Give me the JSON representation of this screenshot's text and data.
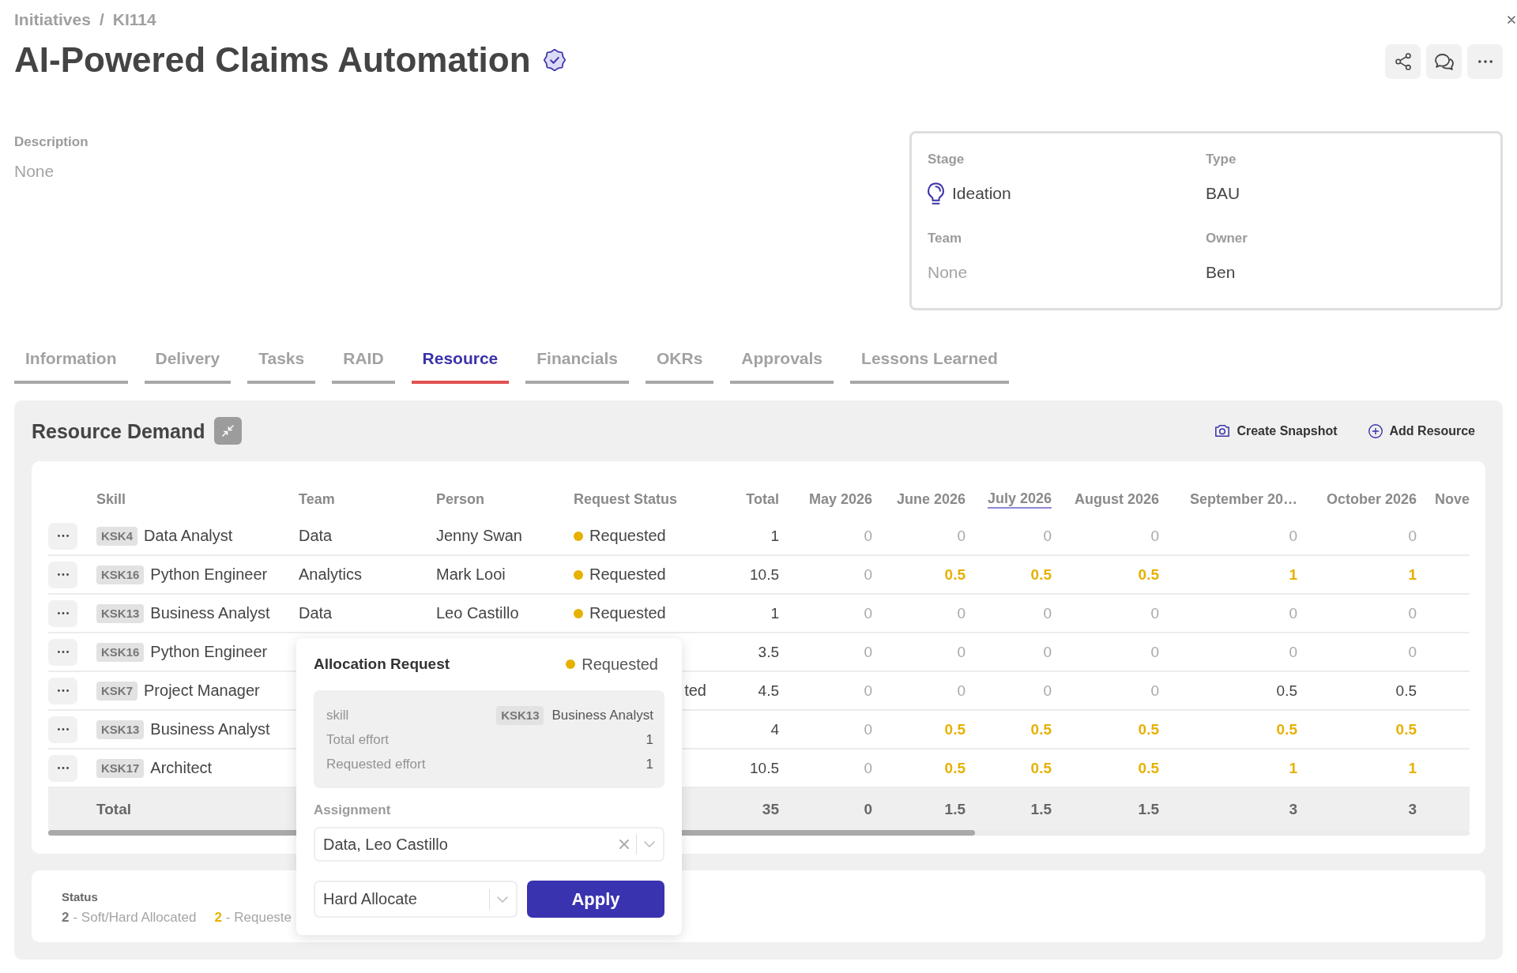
{
  "breadcrumb": {
    "items": [
      "Initiatives",
      "KI114"
    ],
    "separator": "/"
  },
  "title": "AI-Powered Claims Automation",
  "verified": true,
  "header_actions": [
    {
      "kind": "share"
    },
    {
      "kind": "comments"
    },
    {
      "kind": "more"
    }
  ],
  "description": {
    "label": "Description",
    "value": "None",
    "kind": "empty"
  },
  "details": [
    {
      "label": "Stage",
      "value": "Ideation",
      "kind": "stage"
    },
    {
      "label": "Type",
      "value": "BAU",
      "kind": "text"
    },
    {
      "label": "Team",
      "value": "None",
      "kind": "empty"
    },
    {
      "label": "Owner",
      "value": "Ben",
      "kind": "text"
    }
  ],
  "tabs": [
    {
      "label": "Information",
      "selected": false
    },
    {
      "label": "Delivery",
      "selected": false
    },
    {
      "label": "Tasks",
      "selected": false
    },
    {
      "label": "RAID",
      "selected": false
    },
    {
      "label": "Resource",
      "selected": true
    },
    {
      "label": "Financials",
      "selected": false
    },
    {
      "label": "OKRs",
      "selected": false
    },
    {
      "label": "Approvals",
      "selected": false
    },
    {
      "label": "Lessons Learned",
      "selected": false
    }
  ],
  "resource_demand": {
    "title": "Resource Demand",
    "actions": [
      {
        "label": "Create Snapshot",
        "kind": "snapshot"
      },
      {
        "label": "Add Resource",
        "kind": "add"
      }
    ],
    "table": {
      "columns": [
        {
          "label": "Skill",
          "kind": "text",
          "current": false
        },
        {
          "label": "Team",
          "kind": "text",
          "current": false
        },
        {
          "label": "Person",
          "kind": "text",
          "current": false
        },
        {
          "label": "Request Status",
          "kind": "text",
          "current": false
        },
        {
          "label": "Total",
          "kind": "number",
          "current": false
        },
        {
          "label": "May 2026",
          "kind": "month",
          "current": false
        },
        {
          "label": "June 2026",
          "kind": "month",
          "current": false
        },
        {
          "label": "July 2026",
          "kind": "month",
          "current": true
        },
        {
          "label": "August 2026",
          "kind": "month",
          "current": false
        },
        {
          "label": "September 20…",
          "kind": "month",
          "current": false
        },
        {
          "label": "October 2026",
          "kind": "month",
          "current": false
        },
        {
          "label": "Nove",
          "kind": "month",
          "current": false
        }
      ],
      "rows": [
        {
          "code": "KSK4",
          "skill": "Data Analyst",
          "team": "Data",
          "person": "Jenny Swan",
          "status": {
            "label": "Requested",
            "kind": "requested"
          },
          "total": "1",
          "months": [
            {
              "value": "0",
              "kind": "zero"
            },
            {
              "value": "0",
              "kind": "zero"
            },
            {
              "value": "0",
              "kind": "zero"
            },
            {
              "value": "0",
              "kind": "zero"
            },
            {
              "value": "0",
              "kind": "zero"
            },
            {
              "value": "0",
              "kind": "zero"
            }
          ]
        },
        {
          "code": "KSK16",
          "skill": "Python Engineer",
          "team": "Analytics",
          "person": "Mark Looi",
          "status": {
            "label": "Requested",
            "kind": "requested"
          },
          "total": "10.5",
          "months": [
            {
              "value": "0",
              "kind": "zero"
            },
            {
              "value": "0.5",
              "kind": "requested"
            },
            {
              "value": "0.5",
              "kind": "requested"
            },
            {
              "value": "0.5",
              "kind": "requested"
            },
            {
              "value": "1",
              "kind": "requested"
            },
            {
              "value": "1",
              "kind": "requested"
            }
          ]
        },
        {
          "code": "KSK13",
          "skill": "Business Analyst",
          "team": "Data",
          "person": "Leo Castillo",
          "status": {
            "label": "Requested",
            "kind": "requested"
          },
          "total": "1",
          "months": [
            {
              "value": "0",
              "kind": "zero"
            },
            {
              "value": "0",
              "kind": "zero"
            },
            {
              "value": "0",
              "kind": "zero"
            },
            {
              "value": "0",
              "kind": "zero"
            },
            {
              "value": "0",
              "kind": "zero"
            },
            {
              "value": "0",
              "kind": "zero"
            }
          ]
        },
        {
          "code": "KSK16",
          "skill": "Python Engineer",
          "total": "3.5",
          "months": [
            {
              "value": "0",
              "kind": "zero"
            },
            {
              "value": "0",
              "kind": "zero"
            },
            {
              "value": "0",
              "kind": "zero"
            },
            {
              "value": "0",
              "kind": "zero"
            },
            {
              "value": "0",
              "kind": "zero"
            },
            {
              "value": "0",
              "kind": "zero"
            }
          ]
        },
        {
          "code": "KSK7",
          "skill": "Project Manager",
          "status": {
            "label": "ted",
            "kind": "cut"
          },
          "total": "4.5",
          "months": [
            {
              "value": "0",
              "kind": "zero"
            },
            {
              "value": "0",
              "kind": "zero"
            },
            {
              "value": "0",
              "kind": "zero"
            },
            {
              "value": "0",
              "kind": "zero"
            },
            {
              "value": "0.5",
              "kind": "allocated"
            },
            {
              "value": "0.5",
              "kind": "allocated"
            }
          ]
        },
        {
          "code": "KSK13",
          "skill": "Business Analyst",
          "total": "4",
          "months": [
            {
              "value": "0",
              "kind": "zero"
            },
            {
              "value": "0.5",
              "kind": "requested"
            },
            {
              "value": "0.5",
              "kind": "requested"
            },
            {
              "value": "0.5",
              "kind": "requested"
            },
            {
              "value": "0.5",
              "kind": "requested"
            },
            {
              "value": "0.5",
              "kind": "requested"
            }
          ]
        },
        {
          "code": "KSK17",
          "skill": "Architect",
          "total": "10.5",
          "months": [
            {
              "value": "0",
              "kind": "zero"
            },
            {
              "value": "0.5",
              "kind": "requested"
            },
            {
              "value": "0.5",
              "kind": "requested"
            },
            {
              "value": "0.5",
              "kind": "requested"
            },
            {
              "value": "1",
              "kind": "requested"
            },
            {
              "value": "1",
              "kind": "requested"
            }
          ]
        }
      ],
      "totals": {
        "label": "Total",
        "total": "35",
        "months": [
          "0",
          "1.5",
          "1.5",
          "1.5",
          "3",
          "3"
        ]
      }
    }
  },
  "allocation_request": {
    "title": "Allocation Request",
    "status": {
      "label": "Requested",
      "kind": "requested"
    },
    "details": [
      {
        "label": "skill",
        "code": "KSK13",
        "value": "Business Analyst"
      },
      {
        "label": "Total effort",
        "value": "1"
      },
      {
        "label": "Requested effort",
        "value": "1"
      }
    ],
    "assignment": {
      "label": "Assignment",
      "value": "Data, Leo Castillo",
      "clearable": true
    },
    "allocation_type": {
      "value": "Hard Allocate"
    },
    "apply_button": "Apply"
  },
  "status_legend": {
    "title": "Status",
    "items": [
      {
        "count": "2",
        "label": "- Soft/Hard Allocated",
        "color": "#777777"
      },
      {
        "count": "2",
        "label": "- Requeste",
        "color": "#e6b100"
      }
    ]
  }
}
